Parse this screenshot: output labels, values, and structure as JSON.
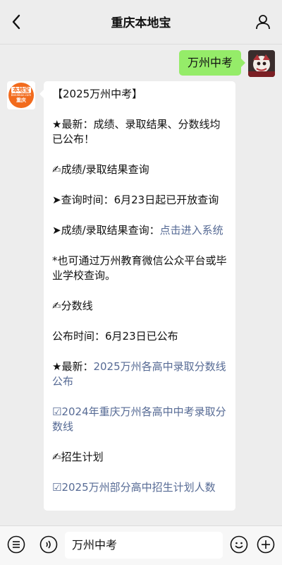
{
  "header": {
    "title": "重庆本地宝",
    "back_icon": "chevron-left-icon",
    "profile_icon": "person-icon"
  },
  "chat": {
    "outgoing": {
      "text": "万州中考"
    },
    "bot_avatar": {
      "logo_top": "本地宝",
      "logo_mid": "Bendibao.com",
      "logo_bottom": "重庆"
    },
    "incoming": {
      "heading": "【2025万州中考】",
      "latest": "★最新：成绩、录取结果、分数线均已公布！",
      "section1": "✍成绩/录取结果查询",
      "query_time": "➤查询时间：6月23日起已开放查询",
      "query_prefix": "➤成绩/录取结果查询：",
      "query_link": "点击进入系统",
      "alt_query": "*也可通过万州教育微信公众平台或毕业学校查询。",
      "section2": "✍分数线",
      "publish_time": "公布时间：6月23日已公布",
      "latest2_prefix": "★最新：",
      "latest2_link": "2025万州各高中录取分数线公布",
      "link_2024": "☑2024年重庆万州各高中中考录取分数线",
      "section3": "✍招生计划",
      "link_plan": "☑2025万州部分高中招生计划人数"
    }
  },
  "input_bar": {
    "text": "万州中考",
    "menu_icon": "menu-list-icon",
    "voice_icon": "voice-icon",
    "emoji_icon": "emoji-icon",
    "add_icon": "plus-icon"
  },
  "colors": {
    "background": "#ededed",
    "outgoing_bubble": "#95ec69",
    "link": "#576b95",
    "brand_orange": "#f26b1d"
  }
}
